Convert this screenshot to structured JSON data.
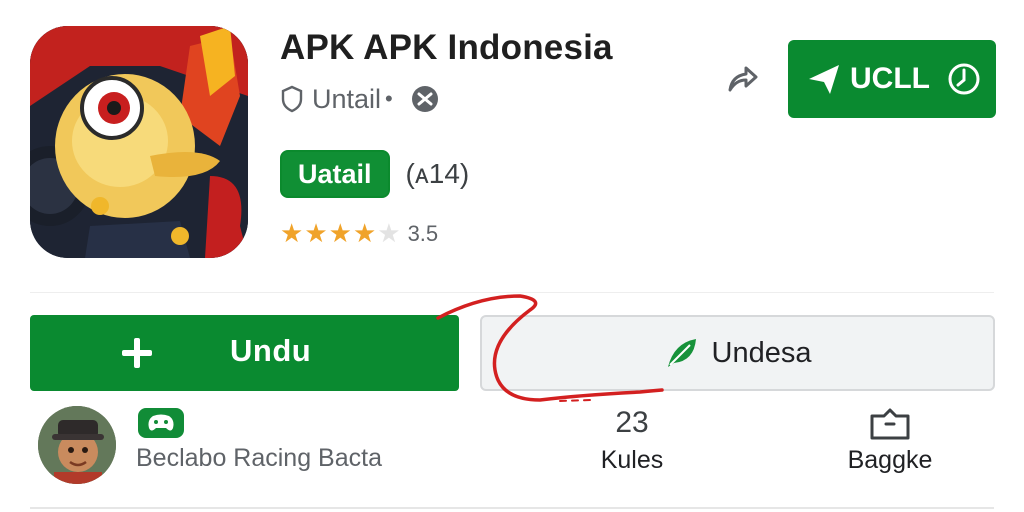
{
  "app": {
    "title": "APK APK Indonesia",
    "developer": "Untail",
    "developer_separator": "•",
    "tag_label": "Uatail",
    "review_count": "(ᴀ14)",
    "rating": 3.5,
    "rating_text": "3.5",
    "stars": [
      "on",
      "on",
      "on",
      "on",
      "off"
    ],
    "icon": "cartoon-duck-warrior-app-icon"
  },
  "header_actions": {
    "share_icon": "share-arrow-icon",
    "cta_label": "UCLL",
    "cta_icons": [
      "paper-plane-icon",
      "clock-icon"
    ]
  },
  "actions": {
    "install_label": "Undu",
    "secondary_label": "Undesa"
  },
  "bottom": {
    "game_name": "Beclabo Racing Bacta",
    "stat_count": "23",
    "stat_label": "Kules",
    "bag_label": "Baggke"
  },
  "colors": {
    "primary_green": "#0a8a30",
    "star_gold": "#f0a32a",
    "annotation_red": "#d32020",
    "secondary_bg": "#f1f3f4"
  }
}
